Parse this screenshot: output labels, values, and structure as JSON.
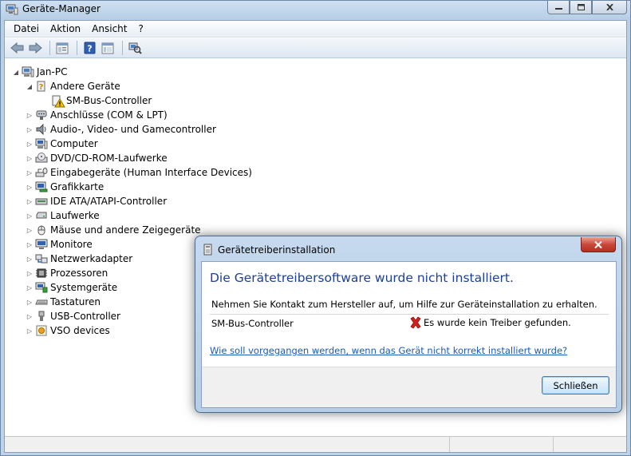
{
  "window": {
    "title": "Geräte-Manager"
  },
  "menu": [
    "Datei",
    "Aktion",
    "Ansicht",
    "?"
  ],
  "toolbar": {
    "icons": [
      "back-icon",
      "forward-icon",
      "properties-icon",
      "help-icon",
      "view-icon",
      "scan-hardware-icon"
    ]
  },
  "tree": {
    "root": "Jan-PC",
    "items": [
      {
        "label": "Andere Geräte",
        "expanded": true,
        "icon": "unknown-device-icon"
      },
      {
        "label": "SM-Bus-Controller",
        "child": true,
        "icon": "warning-device-icon"
      },
      {
        "label": "Anschlüsse (COM & LPT)",
        "icon": "port-icon"
      },
      {
        "label": "Audio-, Video- und Gamecontroller",
        "icon": "audio-icon"
      },
      {
        "label": "Computer",
        "icon": "computer-icon"
      },
      {
        "label": "DVD/CD-ROM-Laufwerke",
        "icon": "dvd-icon"
      },
      {
        "label": "Eingabegeräte (Human Interface Devices)",
        "icon": "hid-icon"
      },
      {
        "label": "Grafikkarte",
        "icon": "display-adapter-icon"
      },
      {
        "label": "IDE ATA/ATAPI-Controller",
        "icon": "ide-icon"
      },
      {
        "label": "Laufwerke",
        "icon": "drive-icon"
      },
      {
        "label": "Mäuse und andere Zeigegeräte",
        "icon": "mouse-icon"
      },
      {
        "label": "Monitore",
        "icon": "monitor-icon"
      },
      {
        "label": "Netzwerkadapter",
        "icon": "network-icon"
      },
      {
        "label": "Prozessoren",
        "icon": "processor-icon"
      },
      {
        "label": "Systemgeräte",
        "icon": "system-device-icon"
      },
      {
        "label": "Tastaturen",
        "icon": "keyboard-icon"
      },
      {
        "label": "USB-Controller",
        "icon": "usb-icon"
      },
      {
        "label": "VSO devices",
        "icon": "vso-icon"
      }
    ]
  },
  "dialog": {
    "title": "Gerätetreiberinstallation",
    "heading": "Die Gerätetreibersoftware wurde nicht installiert.",
    "message": "Nehmen Sie Kontakt zum Hersteller auf, um Hilfe zur Geräteinstallation zu erhalten.",
    "device": "SM-Bus-Controller",
    "error": "Es wurde kein Treiber gefunden.",
    "link": "Wie soll vorgegangen werden, wenn das Gerät nicht korrekt installiert wurde?",
    "close_button": "Schließen"
  },
  "colors": {
    "heading": "#1e3f9c",
    "link": "#1a5bb5",
    "error": "#d4201b"
  }
}
